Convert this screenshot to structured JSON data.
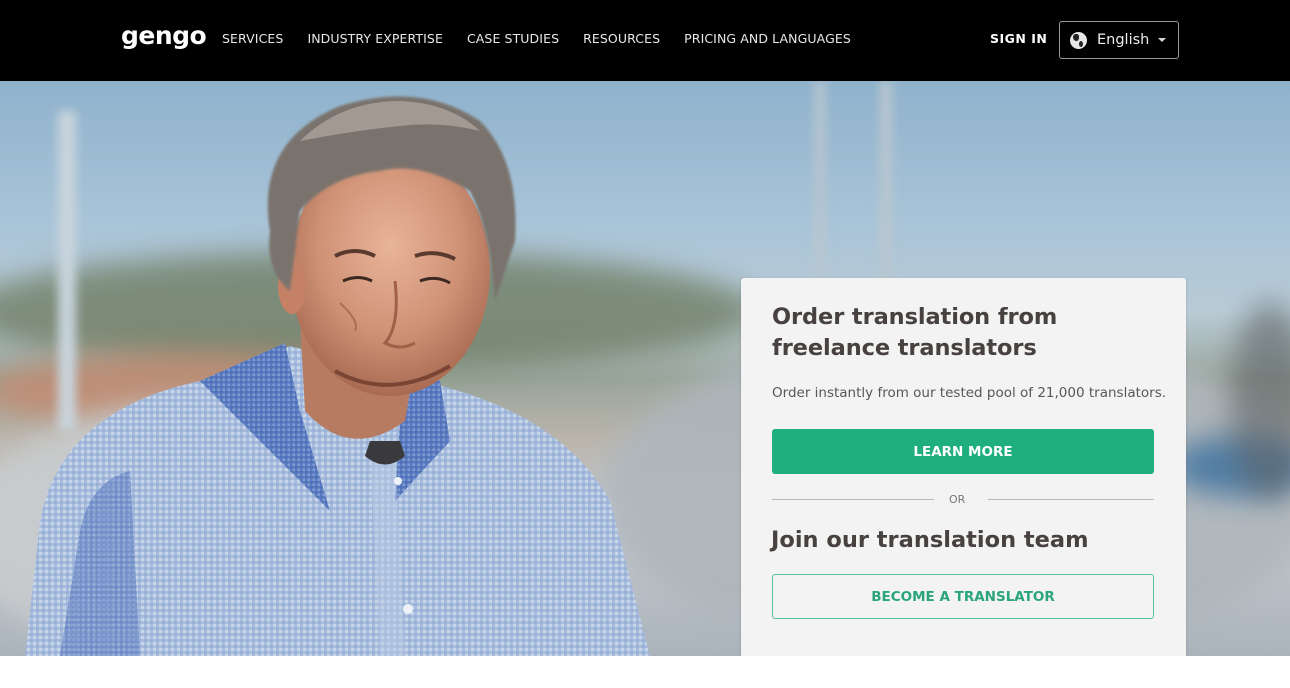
{
  "header": {
    "logo": "gengo",
    "nav": [
      {
        "label": "SERVICES"
      },
      {
        "label": "INDUSTRY EXPERTISE"
      },
      {
        "label": "CASE STUDIES"
      },
      {
        "label": "RESOURCES"
      },
      {
        "label": "PRICING AND LANGUAGES"
      }
    ],
    "sign_in": "SIGN IN",
    "language": {
      "icon": "globe-icon",
      "selected": "English",
      "dropdown_icon": "caret-down-icon"
    }
  },
  "hero": {
    "image_description": "Smiling man in blue checked shirt standing at a marina",
    "card": {
      "title": "Order translation from freelance translators",
      "subtitle": "Order instantly from our tested pool of 21,000 translators.",
      "primary_button": "LEARN MORE",
      "divider_label": "OR",
      "title2": "Join our translation team",
      "secondary_button": "BECOME A TRANSLATOR"
    }
  },
  "colors": {
    "brand_green": "#1fae7e",
    "outline_green": "#57c29b",
    "nav_bg": "#000000",
    "card_bg": "#f3f3f3",
    "heading_text": "#474240"
  }
}
